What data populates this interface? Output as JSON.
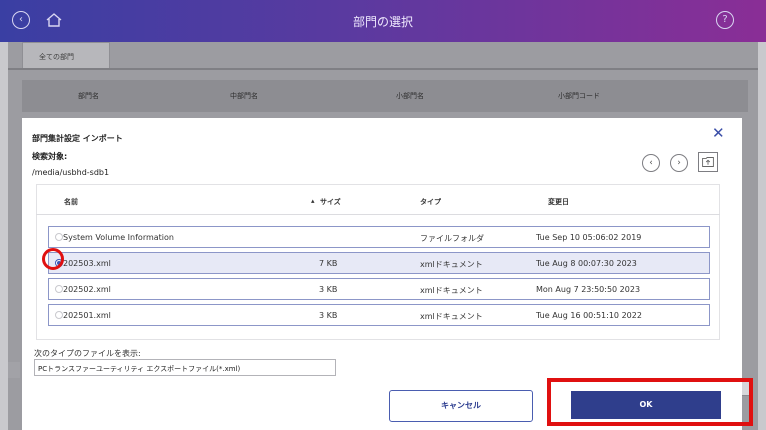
{
  "header": {
    "title": "部門の選択",
    "back_icon": "back-icon",
    "home_icon": "home-icon",
    "help_icon": "help-icon"
  },
  "background": {
    "tab_label": "全ての部門",
    "columns": [
      "部門名",
      "中部門名",
      "小部門名",
      "小部門コード"
    ]
  },
  "dialog": {
    "title": "部門集計設定 インポート",
    "search_label": "検索対象:",
    "path": "/media/usbhd-sdb1",
    "columns": {
      "name": "名前",
      "size": "サイズ",
      "type": "タイプ",
      "date": "変更日"
    },
    "files": [
      {
        "name": "System Volume Information",
        "size": "",
        "type": "ファイルフォルダ",
        "date": "Tue Sep 10 05:06:02 2019",
        "selected": false
      },
      {
        "name": "202503.xml",
        "size": "7 KB",
        "type": "xmlドキュメント",
        "date": "Tue Aug 8 00:07:30 2023",
        "selected": true
      },
      {
        "name": "202502.xml",
        "size": "3 KB",
        "type": "xmlドキュメント",
        "date": "Mon Aug 7 23:50:50 2023",
        "selected": false
      },
      {
        "name": "202501.xml",
        "size": "3 KB",
        "type": "xmlドキュメント",
        "date": "Tue Aug 16 00:51:10 2022",
        "selected": false
      }
    ],
    "file_type_label": "次のタイプのファイルを表示:",
    "file_type_value": "PCトランスファーユーティリティ エクスポートファイル(*.xml)",
    "cancel_label": "キャンセル",
    "ok_label": "OK"
  },
  "colors": {
    "header_gradient_start": "#3a3fa3",
    "header_gradient_end": "#8a2e96",
    "primary": "#2f3e8c",
    "highlight": "#e01010"
  }
}
